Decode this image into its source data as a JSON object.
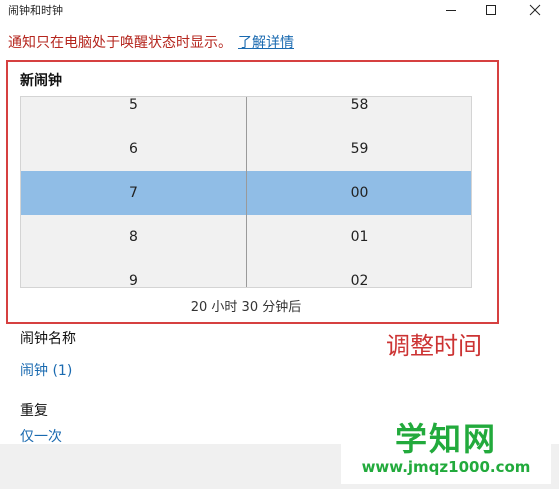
{
  "window": {
    "title": "闹钟和时钟",
    "minimize_icon": "minimize-icon",
    "maximize_icon": "maximize-icon",
    "close_icon": "close-icon"
  },
  "notice": {
    "text": "通知只在电脑处于唤醒状态时显示。",
    "link": "了解详情"
  },
  "alarm": {
    "section_title": "新闹钟",
    "hours": [
      "5",
      "6",
      "7",
      "8",
      "9"
    ],
    "minutes": [
      "58",
      "59",
      "00",
      "01",
      "02"
    ],
    "selected_hour": "7",
    "selected_minute": "00",
    "countdown": "20 小时 30 分钟后",
    "name_label": "闹钟名称",
    "name_value": "闹钟 (1)",
    "repeat_label": "重复",
    "repeat_value": "仅一次"
  },
  "annotation": "调整时间",
  "watermark": {
    "title": "学知网",
    "url": "www.jmqz1000.com"
  },
  "colors": {
    "notice_text": "#b5261e",
    "link": "#1a6ab0",
    "selection": "#90bde6",
    "frame": "#d64040",
    "watermark": "#22aa3c"
  }
}
